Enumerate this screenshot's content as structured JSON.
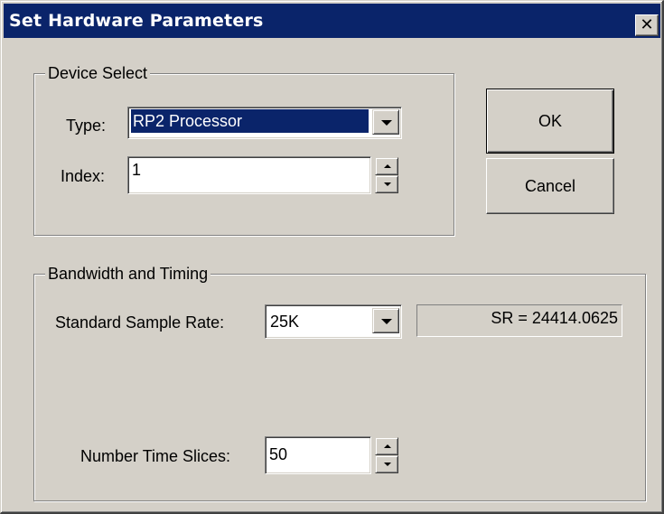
{
  "window": {
    "title": "Set Hardware Parameters",
    "close_glyph": "✕",
    "close_icon": "close-icon"
  },
  "device_select": {
    "legend": "Device Select",
    "type_label": "Type:",
    "type_value": "RP2  Processor",
    "index_label": "Index:",
    "index_value": "1"
  },
  "buttons": {
    "ok_label": "OK",
    "cancel_label": "Cancel"
  },
  "bandwidth_timing": {
    "legend": "Bandwidth and Timing",
    "sample_rate_label": "Standard Sample Rate:",
    "sample_rate_value": "25K",
    "sr_readout": "SR =  24414.0625",
    "time_slices_label": "Number Time Slices:",
    "time_slices_value": "50"
  },
  "colors": {
    "titlebar": "#0a246a",
    "face": "#d4d0c8",
    "selection": "#0a246a"
  }
}
